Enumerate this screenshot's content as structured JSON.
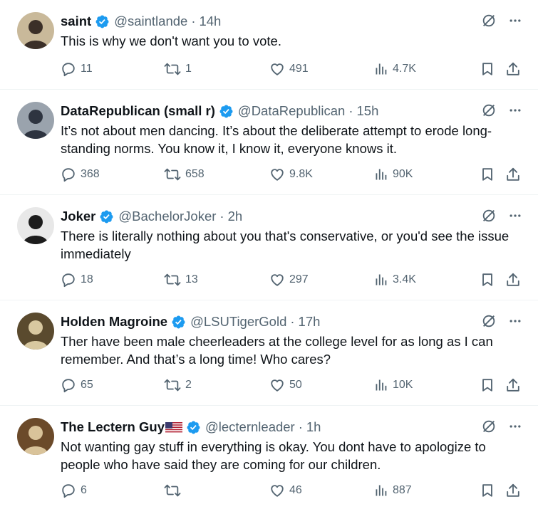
{
  "tweets": [
    {
      "name": "saint",
      "handle": "@saintlande",
      "sep": "·",
      "time": "14h",
      "text": "This is why we don't want you to vote.",
      "replies": "11",
      "retweets": "1",
      "likes": "491",
      "views": "4.7K",
      "avatar_colors": [
        "#c9b99a",
        "#3b2f28"
      ]
    },
    {
      "name": "DataRepublican (small r)",
      "handle": "@DataRepublican",
      "sep": "·",
      "time": "15h",
      "text": "It’s not about men dancing. It’s about the deliberate attempt to erode long-standing norms. You know it, I know it, everyone knows it.",
      "replies": "368",
      "retweets": "658",
      "likes": "9.8K",
      "views": "90K",
      "avatar_colors": [
        "#9aa3ad",
        "#2e3440"
      ]
    },
    {
      "name": "Joker",
      "handle": "@BachelorJoker",
      "sep": "·",
      "time": "2h",
      "text": "There is literally nothing about you that's conservative, or you'd see the issue immediately",
      "replies": "18",
      "retweets": "13",
      "likes": "297",
      "views": "3.4K",
      "avatar_colors": [
        "#e8e8e8",
        "#1c1c1c"
      ]
    },
    {
      "name": "Holden Magroine",
      "handle": "@LSUTigerGold",
      "sep": "·",
      "time": "17h",
      "text": "Ther have been male cheerleaders at the college level for as long as I can remember. And that’s a long time! Who cares?",
      "replies": "65",
      "retweets": "2",
      "likes": "50",
      "views": "10K",
      "avatar_colors": [
        "#5a4a2e",
        "#d8c8a0"
      ]
    },
    {
      "name": "The Lectern Guy",
      "handle": "@lecternleader",
      "sep": "·",
      "time": "1h",
      "text": "Not wanting gay stuff in everything is okay. You dont have to apologize to people who have said they are coming for our children.",
      "replies": "6",
      "retweets": "",
      "likes": "46",
      "views": "887",
      "avatar_colors": [
        "#6b4a2a",
        "#d9c39a"
      ]
    }
  ],
  "colors": {
    "text": "#0f1419",
    "muted": "#536471",
    "verified": "#1d9bf0",
    "divider": "#eff3f4"
  },
  "icons": {
    "verified": "verified-badge-icon",
    "grok": "grok-icon",
    "more": "more-icon",
    "reply": "reply-icon",
    "retweet": "retweet-icon",
    "like": "heart-icon",
    "views": "views-icon",
    "bookmark": "bookmark-icon",
    "share": "share-icon"
  }
}
